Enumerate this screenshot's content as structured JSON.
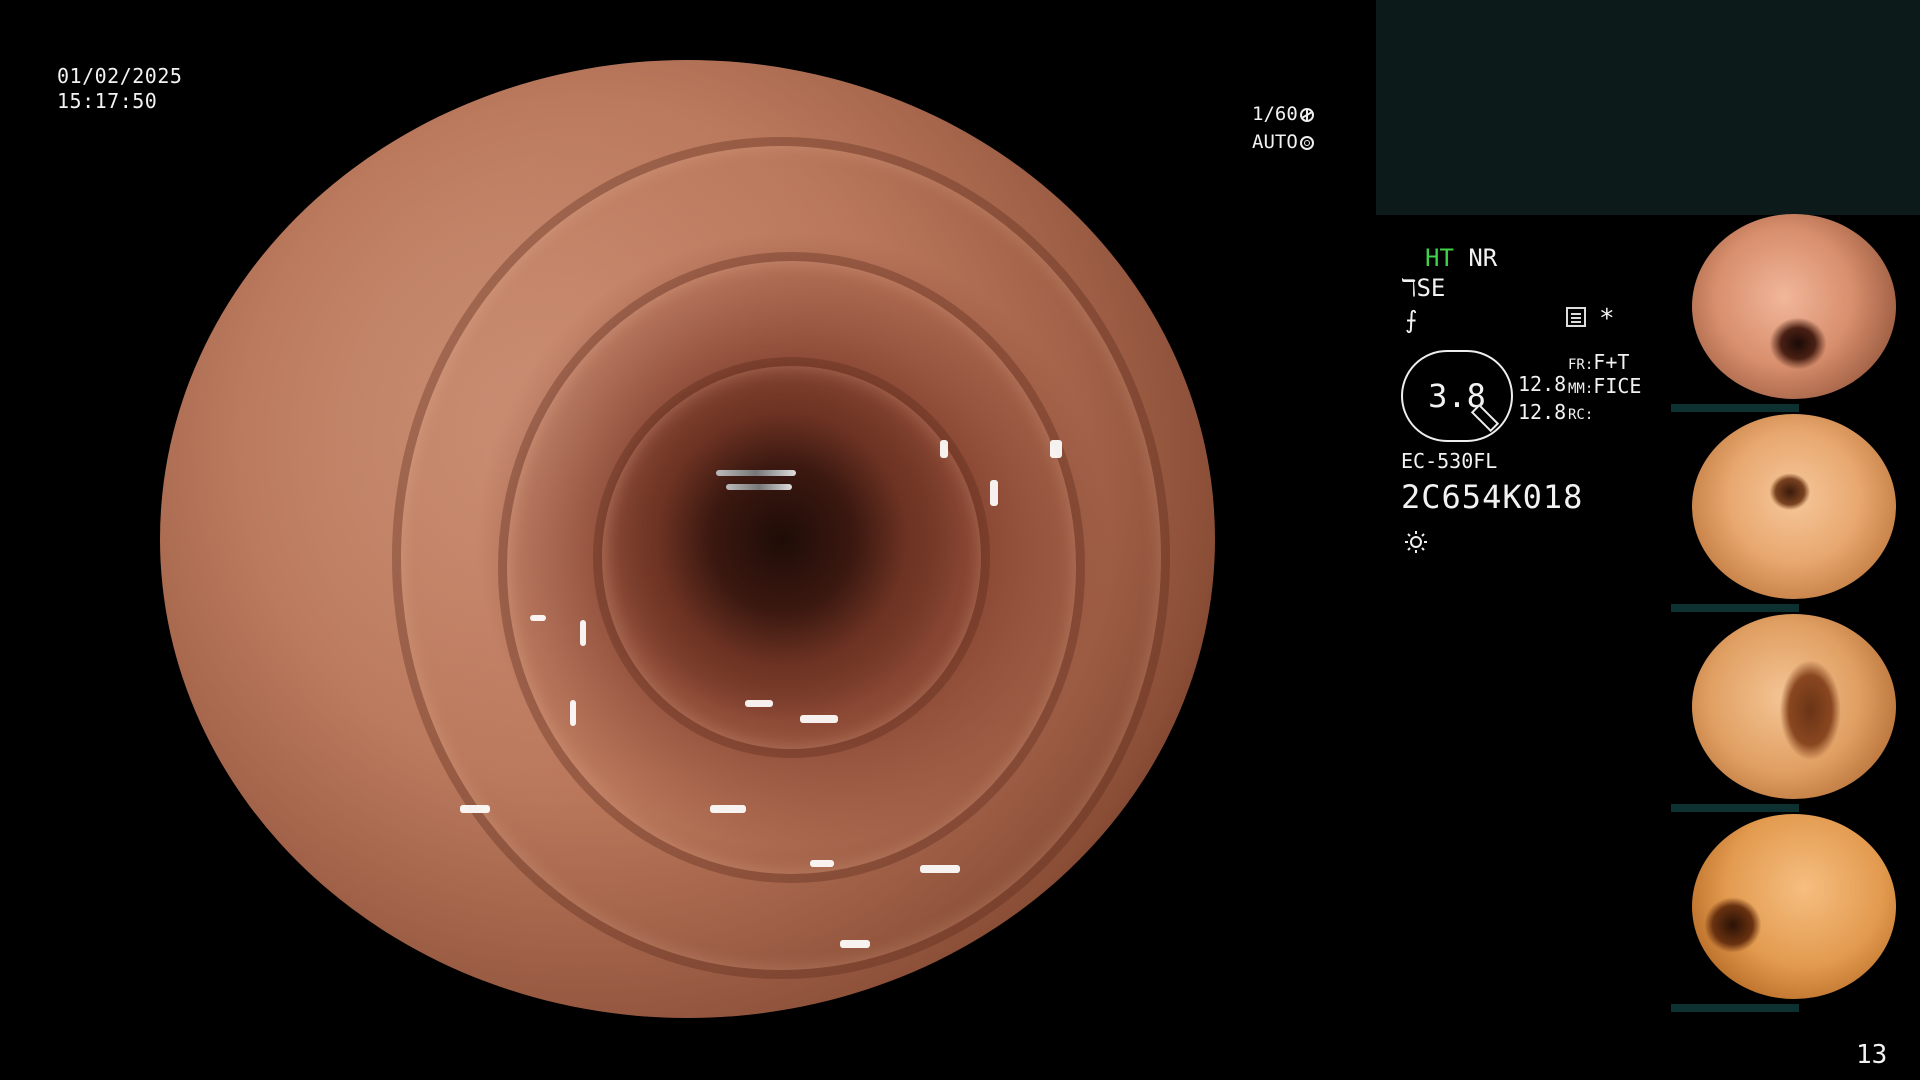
{
  "overlay": {
    "date": "01/02/2025",
    "time": "15:17:50",
    "shutter": "1/60",
    "iris": "AUTO",
    "mode_ht": "HT",
    "mode_nr": "NR",
    "se": "SE",
    "zoom": "3.8",
    "value_a": "12.8",
    "value_b": "12.8",
    "fr_label": "FR:",
    "fr_value": "F+T",
    "mm_label": "MM:",
    "mm_value": "FICE",
    "rc_label": "RC:",
    "model": "EC-530FL",
    "serial": "2C654K018",
    "asterisk": "*",
    "page_number": "13"
  },
  "icons": {
    "shutter": "aperture-icon",
    "iris": "iris-icon",
    "structure": "structure-enhance-icon",
    "memo": "memo-icon",
    "light": "sun-icon"
  },
  "colors": {
    "ht_green": "#3fd24a",
    "panel": "#0d1a1a",
    "thumb_bar": "#0d3030"
  }
}
